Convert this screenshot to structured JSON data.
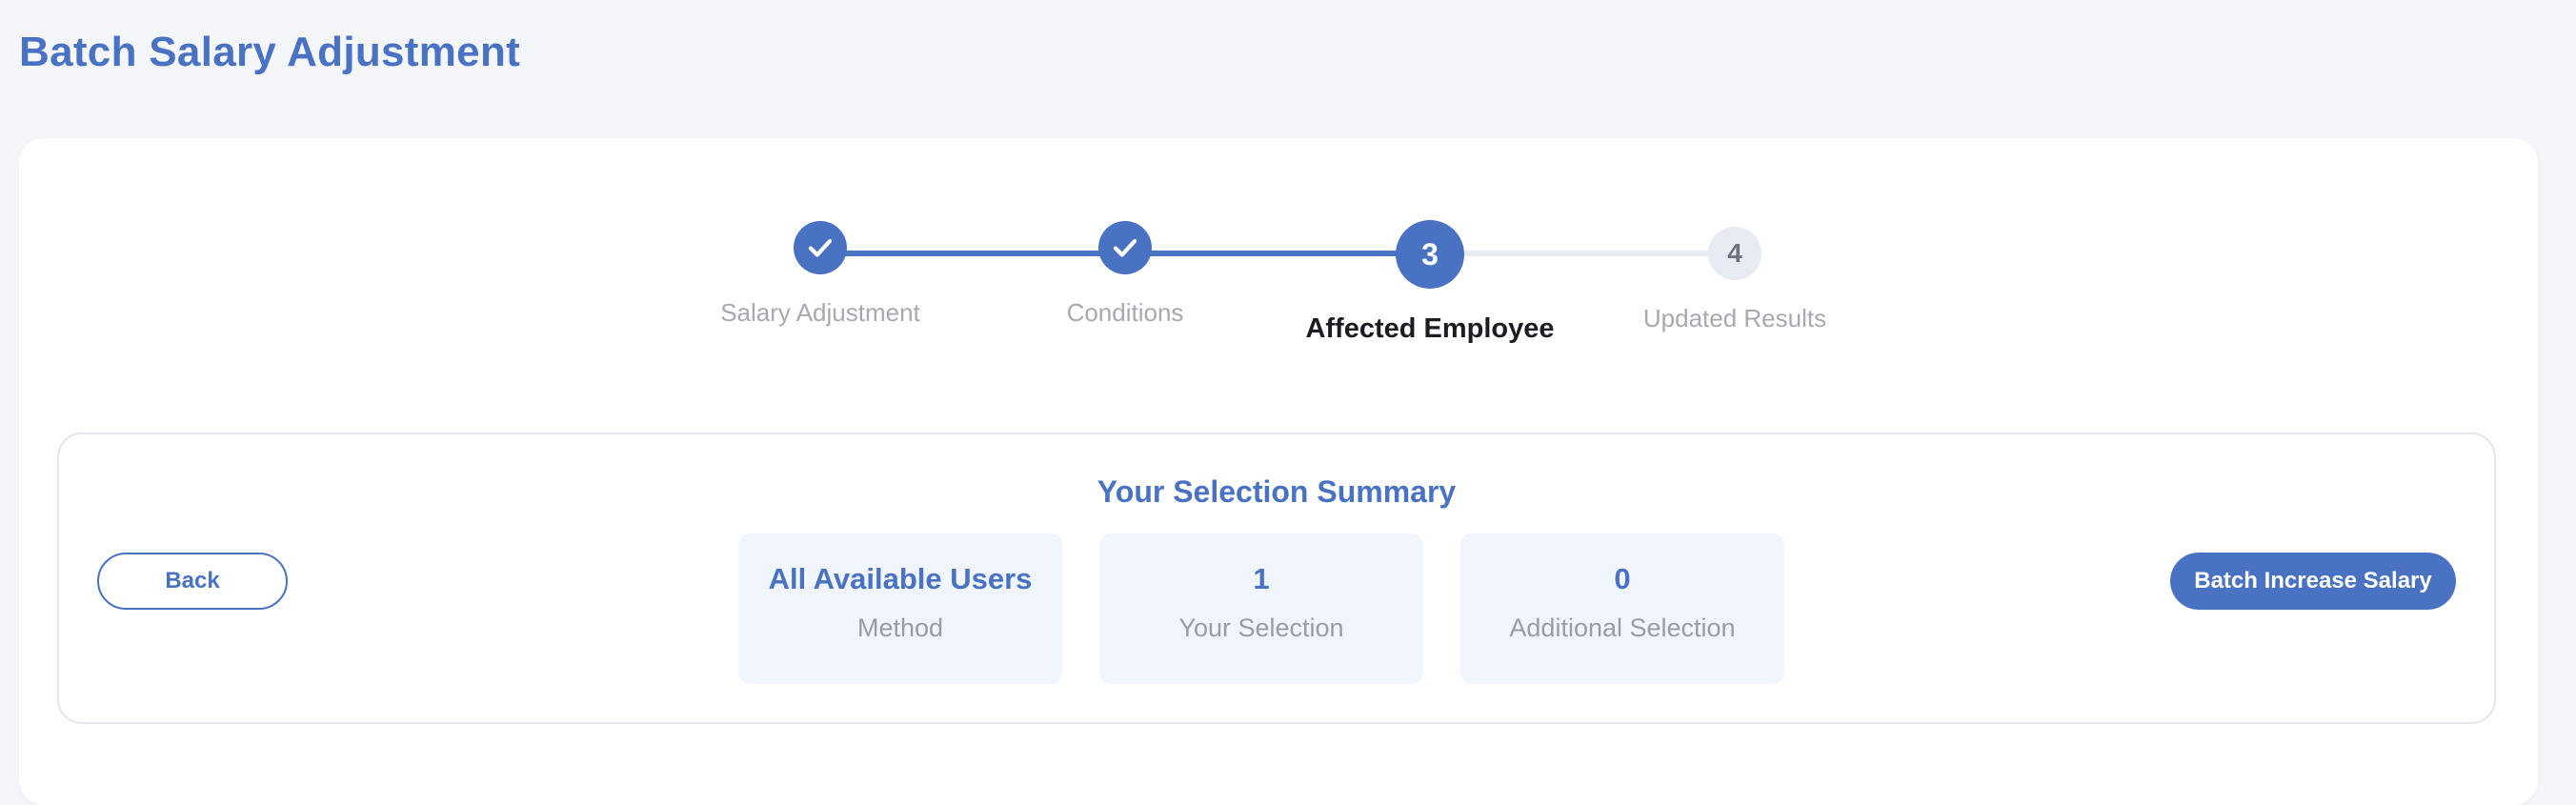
{
  "page": {
    "title": "Batch Salary Adjustment"
  },
  "stepper": {
    "steps": [
      {
        "label": "Salary Adjustment",
        "status": "completed",
        "icon": "check-icon"
      },
      {
        "label": "Conditions",
        "status": "completed",
        "icon": "check-icon"
      },
      {
        "number": "3",
        "label": "Affected Employee",
        "status": "active"
      },
      {
        "number": "4",
        "label": "Updated Results",
        "status": "pending"
      }
    ]
  },
  "summary": {
    "title": "Your Selection Summary",
    "back_label": "Back",
    "action_label": "Batch Increase Salary",
    "cards": [
      {
        "value": "All Available Users",
        "label": "Method"
      },
      {
        "value": "1",
        "label": "Your Selection"
      },
      {
        "value": "0",
        "label": "Additional Selection"
      }
    ]
  },
  "colors": {
    "accent": "#4a72c2",
    "page_background": "#f5f6fa",
    "card_fill": "#f1f5fd",
    "pending_step": "#e9ebf2"
  }
}
